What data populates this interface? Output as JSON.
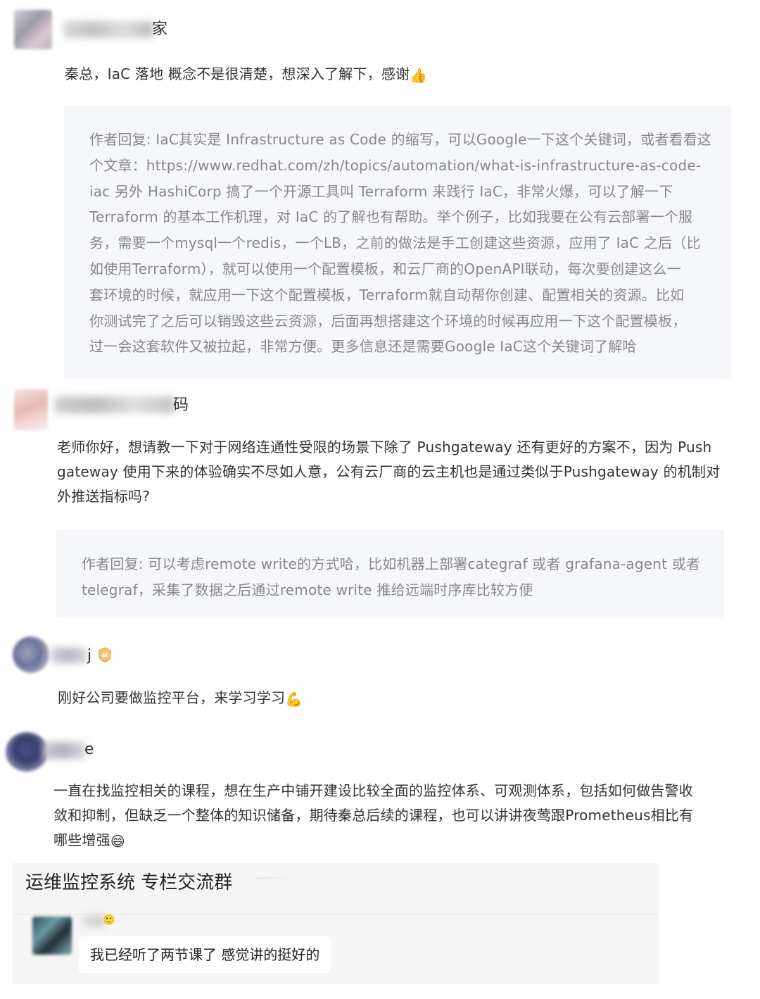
{
  "comments": [
    {
      "name_tail": "家",
      "text": "秦总，IaC 落地 概念不是很清楚，想深入了解下，感谢",
      "emoji": "thumbs-up-icon",
      "reply": {
        "lines": [
          "作者回复: IaC其实是 Infrastructure as Code 的缩写，可以Google一下这个关键词，或者看看这",
          "个文章：https://www.redhat.com/zh/topics/automation/what-is-infrastructure-as-code-",
          "iac 另外 HashiCorp 搞了一个开源工具叫 Terraform 来践行 IaC，非常火爆，可以了解一下",
          "Terraform 的基本工作机理，对 IaC 的了解也有帮助。举个例子，比如我要在公有云部署一个服",
          "务，需要一个mysql一个redis，一个LB，之前的做法是手工创建这些资源，应用了 IaC 之后（比",
          "如使用Terraform），就可以使用一个配置模板，和云厂商的OpenAPI联动，每次要创建这么一",
          "套环境的时候，就应用一下这个配置模板，Terraform就自动帮你创建、配置相关的资源。比如",
          "你测试完了之后可以销毁这些云资源，后面再想搭建这个环境的时候再应用一下这个配置模板，",
          "过一会这套软件又被拉起，非常方便。更多信息还是需要Google IaC这个关键词了解哈"
        ]
      }
    },
    {
      "name_tail": "码",
      "lines": [
        "老师你好，想请教一下对于网络连通性受限的场景下除了 Pushgateway 还有更好的方案不，因为 Push",
        "gateway 使用下来的体验确实不尽如人意，公有云厂商的云主机也是通过类似于Pushgateway 的机制对",
        "外推送指标吗?"
      ],
      "reply": {
        "lines": [
          "作者回复: 可以考虑remote write的方式哈，比如机器上部署categraf 或者 grafana-agent 或者",
          "telegraf，采集了数据之后通过remote write 推给远端时序库比较方便"
        ]
      }
    },
    {
      "name_tail": "j",
      "text": "刚好公司要做监控平台，来学习学习",
      "emoji": "flexed-biceps-icon"
    },
    {
      "name_tail": "e",
      "lines": [
        "一直在找监控相关的课程，想在生产中铺开建设比较全面的监控体系、可观测体系，包括如何做告警收",
        "敛和抑制，但缺乏一个整体的知识储备，期待秦总后续的课程，也可以讲讲夜莺跟Prometheus相比有",
        "哪些增强"
      ],
      "emoji": "grinning-face-icon"
    }
  ],
  "group": {
    "title": "运维监控系统 专栏交流群",
    "message": "我已经听了两节课了 感觉讲的挺好的"
  },
  "colors": {
    "reply_bg": "#f6f7fb",
    "reply_text": "#888888",
    "body_text": "#333333",
    "group_bg": "#f5f5f5"
  }
}
